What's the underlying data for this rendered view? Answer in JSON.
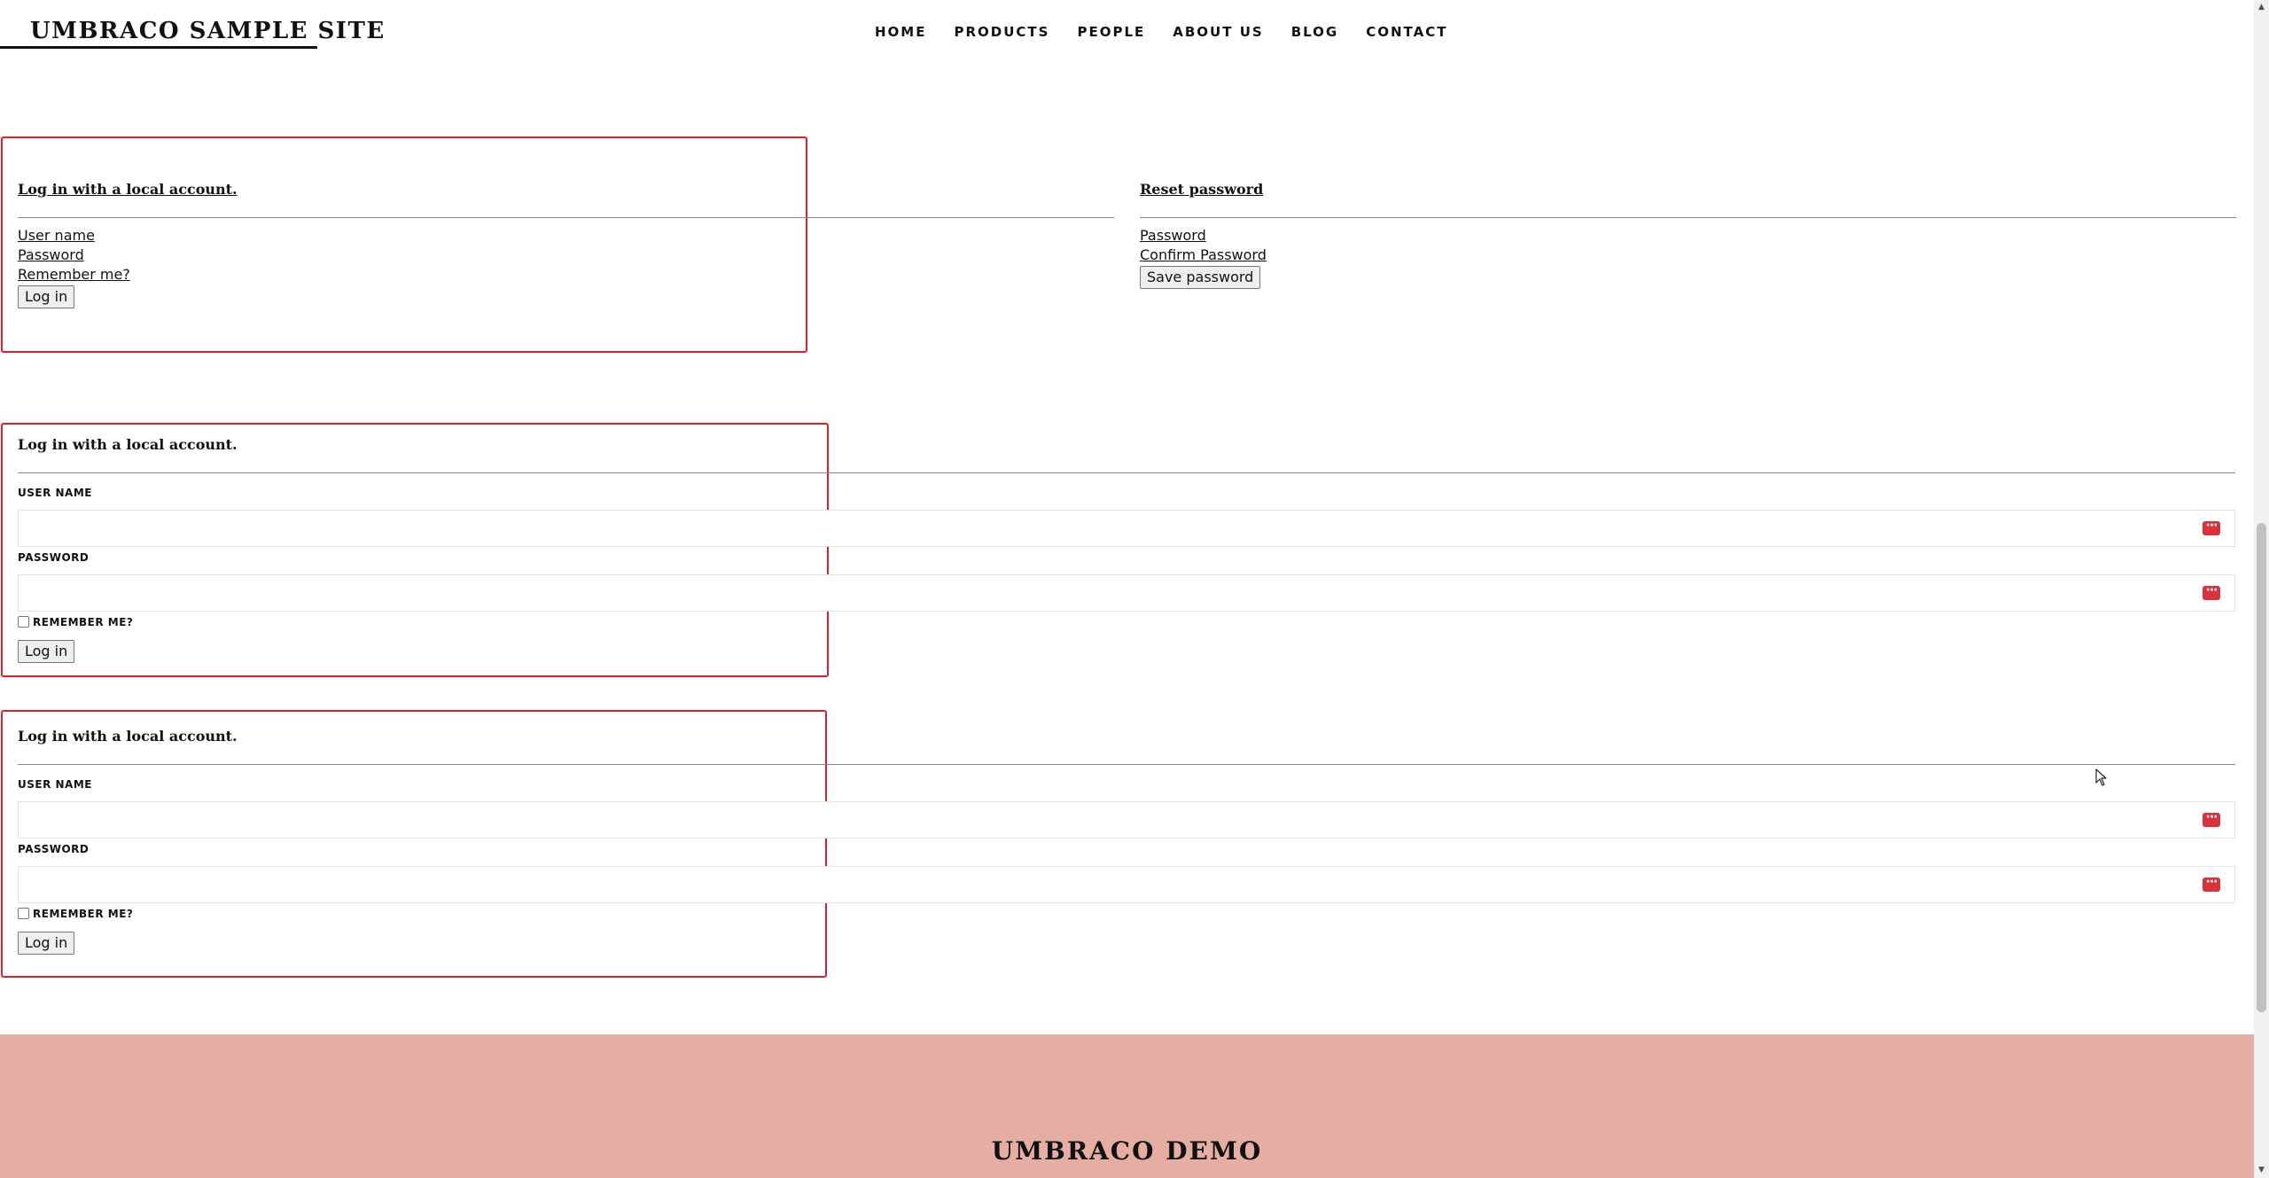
{
  "header": {
    "logo": "UMBRACO SAMPLE SITE",
    "nav": [
      "HOME",
      "PRODUCTS",
      "PEOPLE",
      "ABOUT US",
      "BLOG",
      "CONTACT"
    ]
  },
  "login_plain": {
    "title": "Log in with a local account.",
    "username": "User name",
    "password": "Password",
    "remember": "Remember me?",
    "button": "Log in"
  },
  "reset_plain": {
    "title": "Reset password",
    "password": "Password",
    "confirm": "Confirm Password",
    "button": "Save password"
  },
  "login_form_1": {
    "title": "Log in with a local account.",
    "username_label": "USER NAME",
    "password_label": "PASSWORD",
    "remember_label": "REMEMBER ME?",
    "button": "Log in",
    "badge": "···"
  },
  "login_form_2": {
    "title": "Log in with a local account.",
    "username_label": "USER NAME",
    "password_label": "PASSWORD",
    "remember_label": "REMEMBER ME?",
    "button": "Log in",
    "badge": "···"
  },
  "footer": {
    "title": "UMBRACO DEMO"
  },
  "scrollbar": {
    "up": "▲",
    "down": "▼"
  },
  "colors": {
    "accent_red": "#d9202a",
    "footer_bg": "#e6aea2"
  }
}
